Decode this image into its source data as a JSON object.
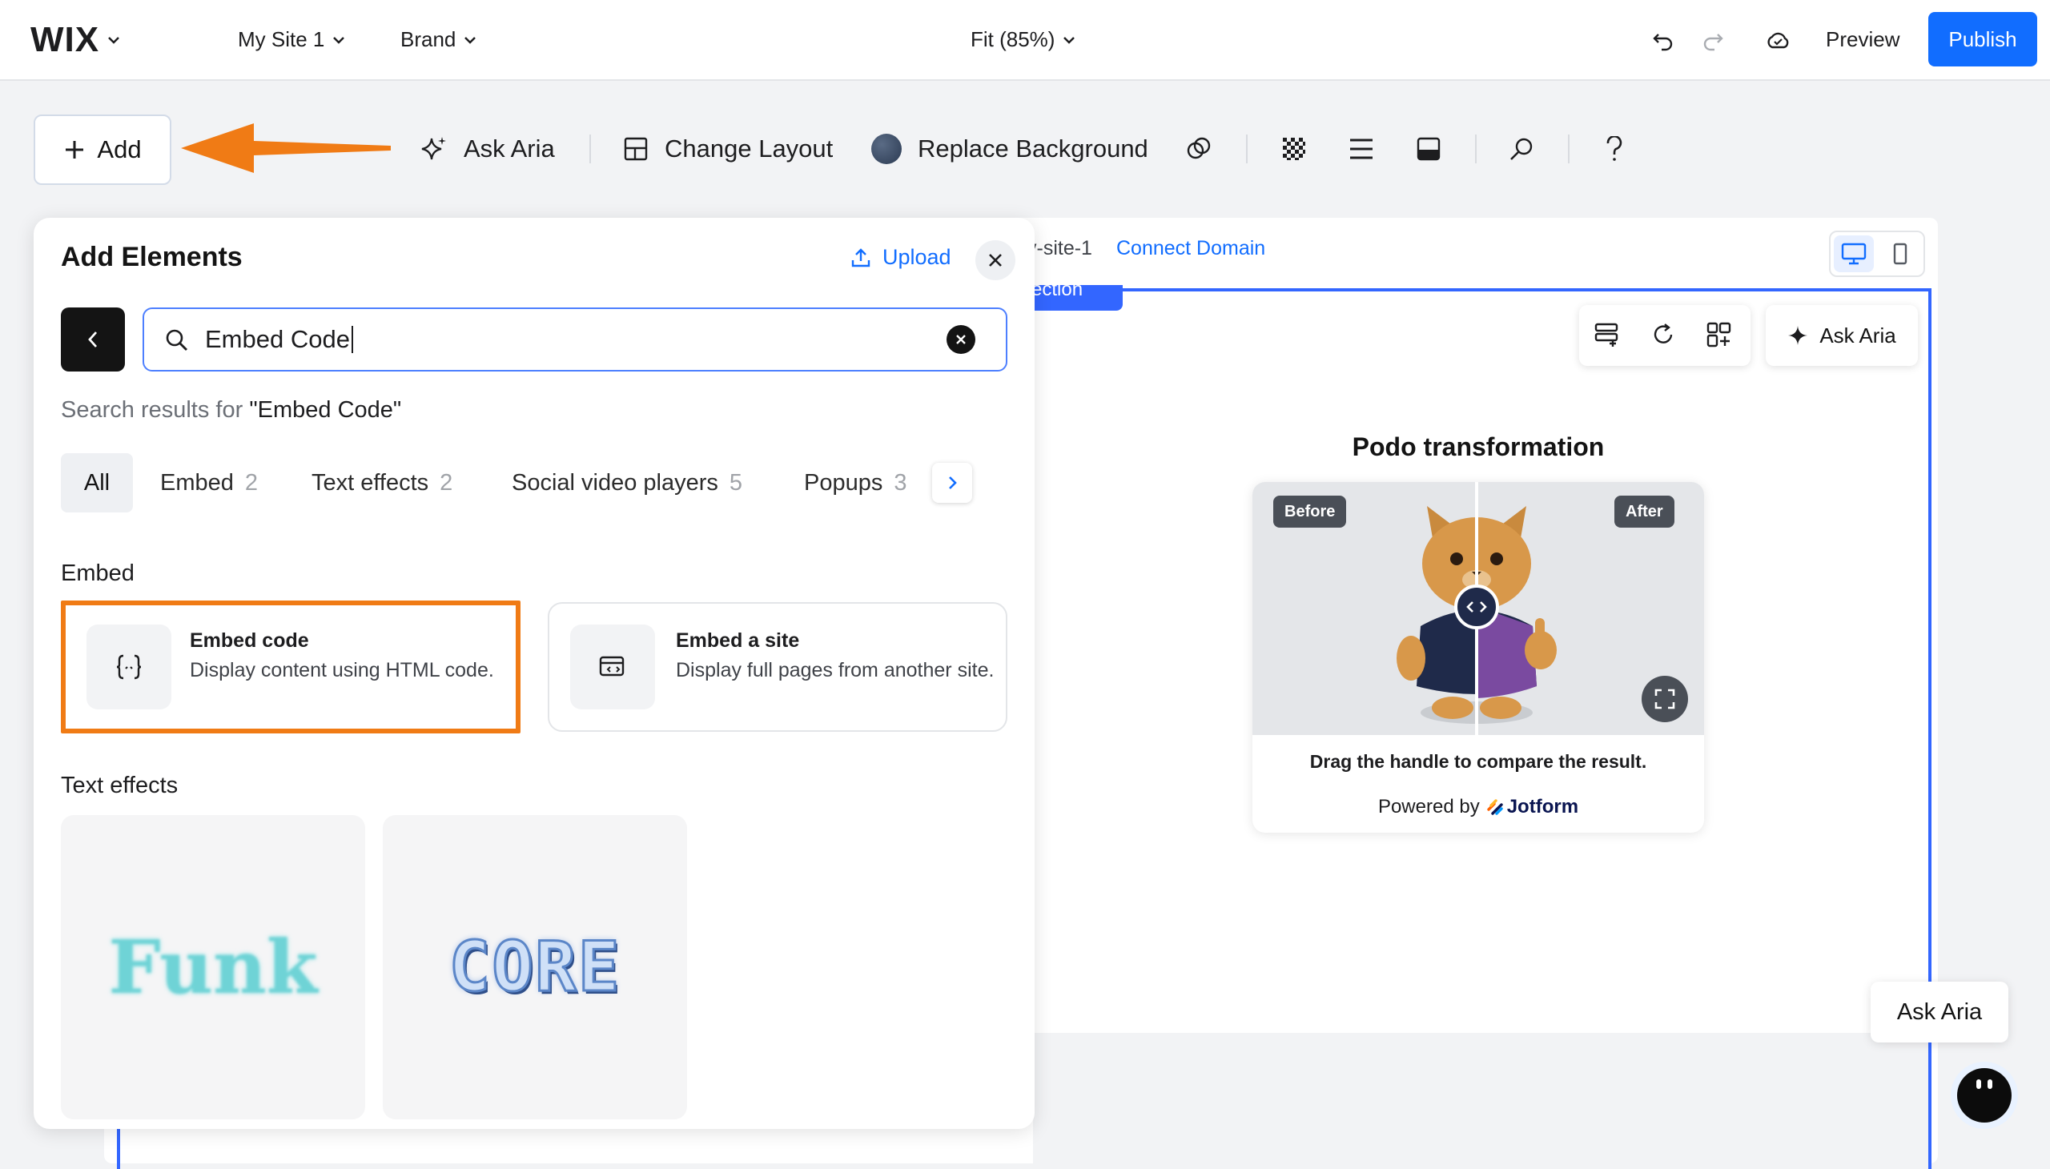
{
  "topbar": {
    "logo": "WIX",
    "site_name": "My Site 1",
    "brand": "Brand",
    "zoom": "Fit (85%)",
    "preview": "Preview",
    "publish": "Publish"
  },
  "toolbar": {
    "add": "Add",
    "ask_aria": "Ask Aria",
    "change_layout": "Change Layout",
    "replace_background": "Replace Background"
  },
  "canvas": {
    "url_fragment": "y-site-1",
    "connect_domain": "Connect Domain",
    "section_tab": "ection",
    "ask_aria": "Ask Aria",
    "widget": {
      "title": "Podo transformation",
      "before_label": "Before",
      "after_label": "After",
      "caption": "Drag the handle to compare the result.",
      "powered_by": "Powered by",
      "brand": "Jotform"
    },
    "floating_aria": "Ask Aria"
  },
  "panel": {
    "title": "Add Elements",
    "upload": "Upload",
    "search_value": "Embed Code",
    "results_prefix": "Search results for ",
    "results_query": "\"Embed Code\"",
    "chips": [
      {
        "label": "All",
        "count": ""
      },
      {
        "label": "Embed",
        "count": "2"
      },
      {
        "label": "Text effects",
        "count": "2"
      },
      {
        "label": "Social video players",
        "count": "5"
      },
      {
        "label": "Popups",
        "count": "3"
      }
    ],
    "embed_heading": "Embed",
    "embed_cards": [
      {
        "title": "Embed code",
        "desc": "Display content using HTML code.",
        "icon": "code-braces-icon"
      },
      {
        "title": "Embed a site",
        "desc": "Display full pages from another site.",
        "icon": "browser-window-code-icon"
      }
    ],
    "text_effects_heading": "Text effects",
    "text_effects": [
      {
        "text": "Funk",
        "color": "#6fd3d6"
      },
      {
        "text": "CORE",
        "color": "#5b86c8"
      }
    ]
  },
  "colors": {
    "primary_blue": "#116dff",
    "highlight_orange": "#f07b15",
    "section_blue": "#3366ff"
  }
}
